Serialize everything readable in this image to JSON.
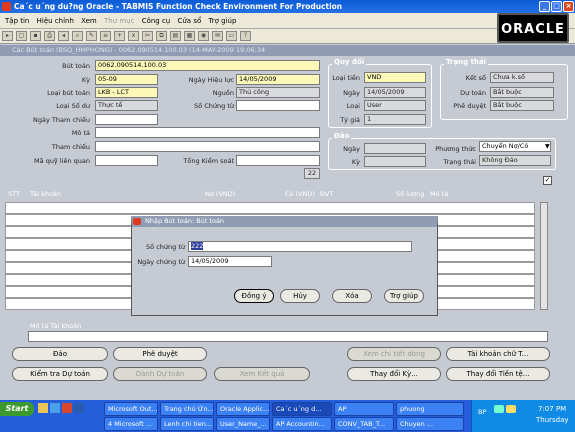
{
  "window": {
    "title": "Ca´c u´ng du?ng Oracle - TABMIS Function Check Environment For Production",
    "brand": "ORACLE"
  },
  "menu": [
    "Tập tin",
    "Hiệu chỉnh",
    "Xem",
    "Thư mục",
    "Công cụ",
    "Cửa sổ",
    "Trợ giúp"
  ],
  "form": {
    "title": "Các Bút toán (BSQ_HMPHONG) - 0062.090514.100.03 (14-MAY-2009 19:06:34",
    "but_toan": {
      "label": "Bút toán",
      "value": "0062.090514.100.03"
    },
    "ky": {
      "label": "Kỳ",
      "value": "05-09"
    },
    "ngay_hieu_luc": {
      "label": "Ngày Hiệu lực",
      "value": "14/05/2009"
    },
    "loai_but_toan": {
      "label": "Loại bút toán",
      "value": "LKB - LCT"
    },
    "nguon": {
      "label": "Nguồn",
      "value": "Thủ công"
    },
    "loai_so_du": {
      "label": "Loại Số dư",
      "value": "Thực tế"
    },
    "so_chung_tu": {
      "label": "Số Chứng từ",
      "value": ""
    },
    "ngay_tham_chieu": {
      "label": "Ngày Tham chiếu",
      "value": ""
    },
    "mo_ta": {
      "label": "Mô tả",
      "value": ""
    },
    "tham_chieu": {
      "label": "Tham chiếu",
      "value": ""
    },
    "ma_quy": {
      "label": "Mã quỹ liên quan",
      "value": ""
    },
    "tong_kiem_soat": {
      "label": "Tổng Kiểm soát",
      "value": ""
    },
    "page_indicator": "22",
    "quy_doi": {
      "header": "Quy đổi",
      "loai_tien_label": "Loại tiền",
      "loai_tien": "VND",
      "ngay_label": "Ngày",
      "ngay": "14/05/2009",
      "loai_label": "Loại",
      "loai": "User",
      "ty_gia_label": "Tỷ giá",
      "ty_gia": "1"
    },
    "trang_thai": {
      "header": "Trạng thái",
      "ket_so_label": "Kết sổ",
      "ket_so": "Chưa k.số",
      "du_toan_label": "Dự toán",
      "du_toan": "Bắt buộc",
      "phe_duyet_label": "Phê duyệt",
      "phe_duyet": "Bắt buộc"
    },
    "dao": {
      "header": "Đảo",
      "ngay_label": "Ngày",
      "ky_label": "Kỳ",
      "phuong_thuc_label": "Phương thức",
      "phuong_thuc": "Chuyển Nợ/Có",
      "trang_thai_label": "Trạng thái",
      "trang_thai": "Không Đảo"
    },
    "grid_headers": [
      "STT",
      "Tài khoản",
      "Nợ (VND)",
      "Có (VND)",
      "ĐVT",
      "Số lượng",
      "Mô tả"
    ],
    "mo_ta_tk": "Mô tả Tài khoản",
    "buttons": {
      "dao": "Đảo",
      "phe_duyet": "Phê duyệt",
      "xem_chi_tiet": "Xem chi tiết dòng",
      "tai_khoan_chu": "Tài khoản chữ T...",
      "kiem_tra": "Kiểm tra Dự toán",
      "danh_du": "Dành Dự toán",
      "xem_ket_qua": "Xem Kết quả",
      "thay_doi_ky": "Thay đổi Kỳ...",
      "thay_doi_tien": "Thay đổi Tiền tệ..."
    }
  },
  "dialog": {
    "title": "Nhập Bút toán: Bút toán",
    "so_chung_tu_label": "Số chứng từ",
    "so_chung_tu": "222",
    "ngay_label": "Ngày chứng từ",
    "ngay": "14/05/2009",
    "buttons": [
      "Đồng ý",
      "Hủy",
      "Xóa",
      "Trợ giúp"
    ]
  },
  "taskbar": {
    "start": "Start",
    "items": [
      "Microsoft Out...",
      "Trang chủ Ứn...",
      "Oracle Applic...",
      "Ca´c u´ng d...",
      "AP",
      "phuong",
      "4 Microsoft ...",
      "Lenh chi tien...",
      "User_Name_...",
      "AP Accountin...",
      "CONV_TAB_T...",
      "Chuyen ..."
    ],
    "lang": "BP",
    "time": "7:07 PM",
    "day": "Thursday"
  }
}
